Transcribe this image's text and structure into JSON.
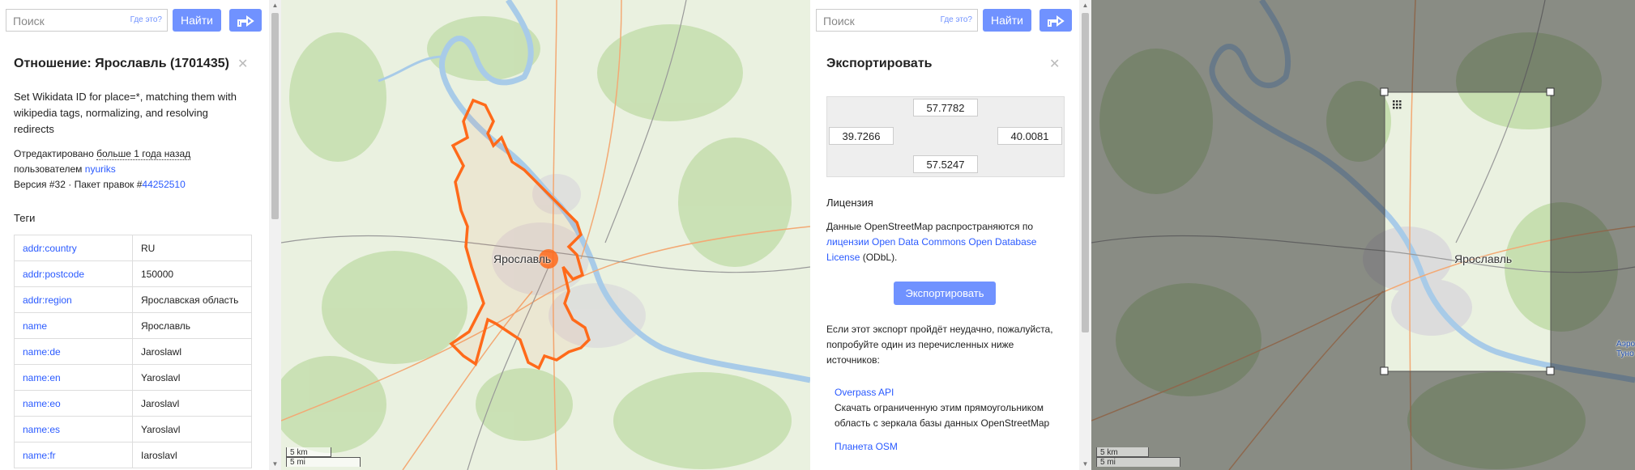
{
  "search": {
    "placeholder": "Поиск",
    "where_link": "Где это?",
    "find_label": "Найти"
  },
  "left_panel": {
    "title": "Отношение: Ярославль (1701435)",
    "description": "Set Wikidata ID for place=*, matching them with wikipedia tags, normalizing, and resolving redirects",
    "edited_prefix": "Отредактировано",
    "edited_time": "больше 1 года назад",
    "by_user_prefix": "пользователем",
    "user": "nyuriks",
    "version_prefix": "Версия #32 · Пакет правок #",
    "changeset": "44252510",
    "tags_heading": "Теги",
    "tags": [
      {
        "key": "addr:country",
        "value": "RU"
      },
      {
        "key": "addr:postcode",
        "value": "150000"
      },
      {
        "key": "addr:region",
        "value": "Ярославская область"
      },
      {
        "key": "name",
        "value": "Ярославль"
      },
      {
        "key": "name:de",
        "value": "Jaroslawl"
      },
      {
        "key": "name:en",
        "value": "Yaroslavl"
      },
      {
        "key": "name:eo",
        "value": "Jaroslavl"
      },
      {
        "key": "name:es",
        "value": "Yaroslavl"
      },
      {
        "key": "name:fr",
        "value": "Iaroslavl"
      }
    ]
  },
  "right_panel": {
    "title": "Экспортировать",
    "bbox": {
      "north": "57.7782",
      "west": "39.7266",
      "east": "40.0081",
      "south": "57.5247"
    },
    "license_heading": "Лицензия",
    "license_prefix": "Данные OpenStreetMap распространяются по",
    "license_link": "лицензии Open Data Commons Open Database License",
    "license_suffix": "(ODbL).",
    "export_button": "Экспортировать",
    "fail_text": "Если этот экспорт пройдёт неудачно, пожалуйста, попробуйте один из перечисленных ниже источников:",
    "sources": [
      {
        "name": "Overpass API",
        "desc": "Скачать ограниченную этим прямоугольником область с зеркала базы данных OpenStreetMap"
      },
      {
        "name": "Планета OSM",
        "desc": ""
      }
    ]
  },
  "map": {
    "city_label": "Ярославль",
    "edge_label_1": "Аэро",
    "edge_label_2": "Туно",
    "scale_km": "5 km",
    "scale_mi": "5 mi"
  },
  "colors": {
    "accent": "#7092ff",
    "link": "#2a5aff",
    "boundary": "#ff6a1a",
    "river": "#a8cbe8"
  }
}
